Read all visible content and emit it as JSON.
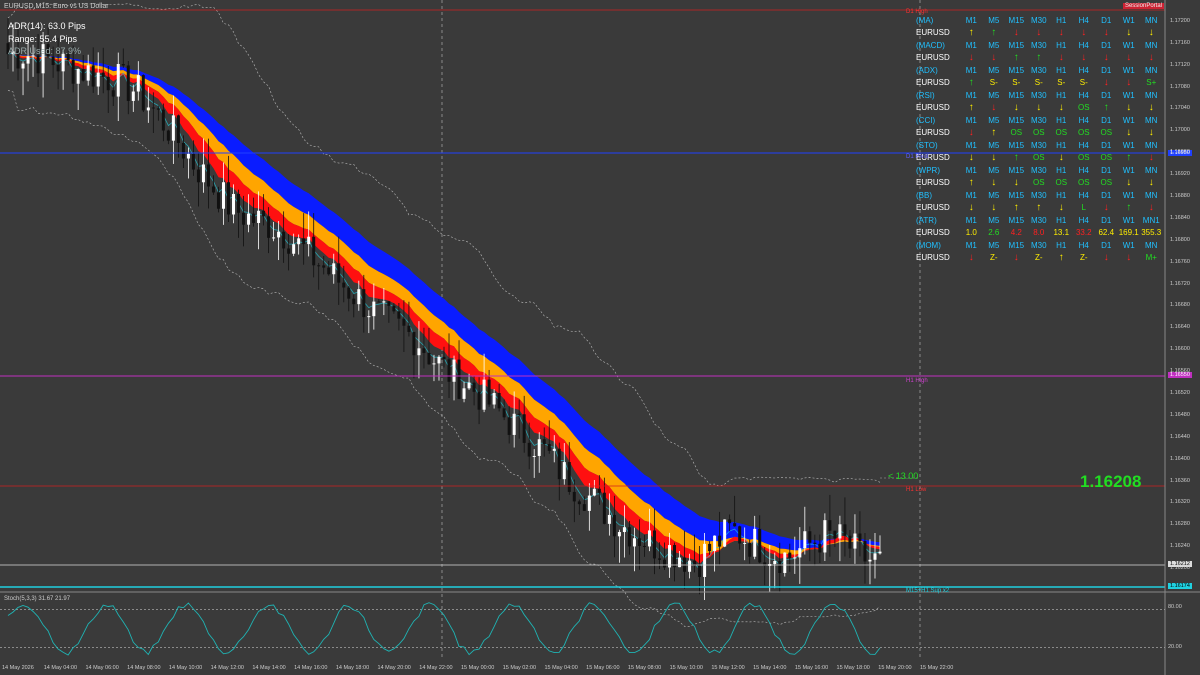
{
  "header": {
    "symbol_title": "EURUSD,M15: Euro vs US Dollar"
  },
  "info": {
    "adr": "ADR(14): 63.0 Pips",
    "range": "Range: 55.4 Pips",
    "adr_used": "ADR Used: 87.9%"
  },
  "panel_title": "SessionPortal",
  "panel": [
    {
      "name": "(MA)",
      "cells": [
        "M1",
        "M5",
        "M15",
        "M30",
        "H1",
        "H4",
        "D1",
        "W1",
        "MN"
      ],
      "kind": "header"
    },
    {
      "name": "EURUSD",
      "cells": [
        "up-y",
        "up-g",
        "dn-r",
        "dn-r",
        "dn-r",
        "dn-r",
        "dn-r",
        "dn-y",
        "dn-y"
      ],
      "kind": "signal"
    },
    {
      "name": "(MACD)",
      "cells": [
        "M1",
        "M5",
        "M15",
        "M30",
        "H1",
        "H4",
        "D1",
        "W1",
        "MN"
      ],
      "kind": "header"
    },
    {
      "name": "EURUSD",
      "cells": [
        "dn-r",
        "dn-r",
        "up-g",
        "up-g",
        "dn-r",
        "dn-r",
        "dn-r",
        "dn-r",
        "dn-r"
      ],
      "kind": "signal"
    },
    {
      "name": "(ADX)",
      "cells": [
        "M1",
        "M5",
        "M15",
        "M30",
        "H1",
        "H4",
        "D1",
        "W1",
        "MN"
      ],
      "kind": "header"
    },
    {
      "name": "EURUSD",
      "cells": [
        "up-g",
        "S-",
        "S-",
        "S-",
        "S-",
        "S-",
        "dn-r",
        "dn-r",
        "S+"
      ],
      "kind": "signal"
    },
    {
      "name": "(RSI)",
      "cells": [
        "M1",
        "M5",
        "M15",
        "M30",
        "H1",
        "H4",
        "D1",
        "W1",
        "MN"
      ],
      "kind": "header"
    },
    {
      "name": "EURUSD",
      "cells": [
        "up-y",
        "dn-r",
        "dn-y",
        "dn-y",
        "dn-y",
        "OS",
        "up-g",
        "dn-y",
        "dn-y"
      ],
      "kind": "signal"
    },
    {
      "name": "(CCI)",
      "cells": [
        "M1",
        "M5",
        "M15",
        "M30",
        "H1",
        "H4",
        "D1",
        "W1",
        "MN"
      ],
      "kind": "header"
    },
    {
      "name": "EURUSD",
      "cells": [
        "dn-r",
        "up-y",
        "OS",
        "OS",
        "OS",
        "OS",
        "OS",
        "dn-y",
        "dn-y"
      ],
      "kind": "signal"
    },
    {
      "name": "(STO)",
      "cells": [
        "M1",
        "M5",
        "M15",
        "M30",
        "H1",
        "H4",
        "D1",
        "W1",
        "MN"
      ],
      "kind": "header"
    },
    {
      "name": "EURUSD",
      "cells": [
        "dn-y",
        "dn-y",
        "up-g",
        "OS",
        "dn-y",
        "OS",
        "OS",
        "up-g",
        "dn-r"
      ],
      "kind": "signal"
    },
    {
      "name": "(WPR)",
      "cells": [
        "M1",
        "M5",
        "M15",
        "M30",
        "H1",
        "H4",
        "D1",
        "W1",
        "MN"
      ],
      "kind": "header"
    },
    {
      "name": "EURUSD",
      "cells": [
        "up-y",
        "dn-y",
        "dn-y",
        "OS",
        "OS",
        "OS",
        "OS",
        "dn-y",
        "dn-y"
      ],
      "kind": "signal"
    },
    {
      "name": "(BB)",
      "cells": [
        "M1",
        "M5",
        "M15",
        "M30",
        "H1",
        "H4",
        "D1",
        "W1",
        "MN"
      ],
      "kind": "header"
    },
    {
      "name": "EURUSD",
      "cells": [
        "dn-y",
        "dn-y",
        "up-y",
        "up-y",
        "dn-y",
        "L",
        "dn-r",
        "up-g",
        "dn-r"
      ],
      "kind": "signal"
    },
    {
      "name": "(ATR)",
      "cells": [
        "M1",
        "M5",
        "M15",
        "M30",
        "H1",
        "H4",
        "D1",
        "W1",
        "MN1"
      ],
      "kind": "header"
    },
    {
      "name": "EURUSD",
      "cells": [
        "1.0",
        "2.6",
        "4.2",
        "8.0",
        "13.1",
        "33.2",
        "62.4",
        "169.1",
        "355.3"
      ],
      "kind": "atr"
    },
    {
      "name": "(MOM)",
      "cells": [
        "M1",
        "M5",
        "M15",
        "M30",
        "H1",
        "H4",
        "D1",
        "W1",
        "MN"
      ],
      "kind": "header"
    },
    {
      "name": "EURUSD",
      "cells": [
        "dn-r",
        "Z-",
        "dn-r",
        "Z-",
        "up-y",
        "Z-",
        "dn-r",
        "dn-r",
        "M+"
      ],
      "kind": "signal"
    }
  ],
  "colors": {
    "bg": "#3a3a3a",
    "grid": "#555555",
    "bull": "#ffffff",
    "bear": "#111111",
    "blue": "#0a1cff",
    "orange": "#ffa500",
    "red": "#ff1010",
    "cyan": "#20d0e0",
    "sig_green": "#22dd22",
    "sig_red": "#ff2020",
    "sig_yellow": "#ffee00",
    "header_cyan": "#20c0ff"
  },
  "price_current": "1.16208",
  "adr_label": "< 13.00",
  "level_labels": {
    "top": "D1 High",
    "mid_blue": "D1 Pivot",
    "magenta": "H1 High",
    "red_low": "H1 Low",
    "bottom": "M15+H1 Sup x2"
  },
  "price_tags": {
    "blue": "1.16950",
    "magenta": "1.16550",
    "white": "1.16212",
    "cyan": "1.16174"
  },
  "osc_header": "Stoch(5,3,3) 31.67 21.97",
  "osc_levels": [
    "80.00",
    "20.00"
  ],
  "chart_data": {
    "type": "candlestick",
    "title": "EURUSD,M15: Euro vs US Dollar",
    "y_ticks": [
      "1.17200",
      "1.17160",
      "1.17120",
      "1.17080",
      "1.17040",
      "1.17000",
      "1.16960",
      "1.16920",
      "1.16880",
      "1.16840",
      "1.16800",
      "1.16760",
      "1.16720",
      "1.16680",
      "1.16640",
      "1.16600",
      "1.16560",
      "1.16520",
      "1.16480",
      "1.16440",
      "1.16400",
      "1.16360",
      "1.16320",
      "1.16280",
      "1.16240",
      "1.16200"
    ],
    "ylim": [
      1.1616,
      1.1722
    ],
    "x_ticks": [
      "14 May 2026",
      "14 May 04:00",
      "14 May 06:00",
      "14 May 08:00",
      "14 May 10:00",
      "14 May 12:00",
      "14 May 14:00",
      "14 May 16:00",
      "14 May 18:00",
      "14 May 20:00",
      "14 May 22:00",
      "15 May 00:00",
      "15 May 02:00",
      "15 May 04:00",
      "15 May 06:00",
      "15 May 08:00",
      "15 May 10:00",
      "15 May 12:00",
      "15 May 14:00",
      "15 May 16:00",
      "15 May 18:00",
      "15 May 20:00",
      "15 May 22:00"
    ],
    "close_trend": [
      1.1714,
      1.1714,
      1.1713,
      1.1712,
      1.1711,
      1.171,
      1.1709,
      1.1707,
      1.1703,
      1.1699,
      1.1694,
      1.169,
      1.1686,
      1.1684,
      1.1683,
      1.1681,
      1.1678,
      1.1675,
      1.1672,
      1.1669,
      1.1666,
      1.1664,
      1.1662,
      1.1658,
      1.1655,
      1.1653,
      1.165,
      1.1647,
      1.1644,
      1.1641,
      1.1637,
      1.1634,
      1.1631,
      1.1628,
      1.1626,
      1.1624,
      1.1623,
      1.1621,
      1.1624,
      1.1627,
      1.1625,
      1.1623,
      1.1622,
      1.1624,
      1.1626,
      1.1625,
      1.1622,
      1.1621
    ]
  }
}
